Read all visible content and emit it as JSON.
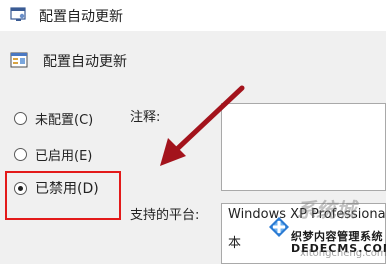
{
  "window": {
    "title": "配置自动更新",
    "header_title": "配置自动更新"
  },
  "options": [
    {
      "label": "未配置(C)",
      "checked": false
    },
    {
      "label": "已启用(E)",
      "checked": false
    },
    {
      "label": "已禁用(D)",
      "checked": true
    }
  ],
  "fields": {
    "comment_label": "注释:",
    "platform_label": "支持的平台:",
    "platform_value": "Windows XP Professional",
    "platform_value2": "本"
  },
  "watermark": {
    "site_cn": "织梦内容管理系统",
    "site_url": "DEDECMS.COM",
    "faint_text": "xitongcheng.com"
  },
  "colors": {
    "highlight": "#e31a1a",
    "arrow": "#a3131c",
    "panel_bg": "#f0f0f0"
  }
}
